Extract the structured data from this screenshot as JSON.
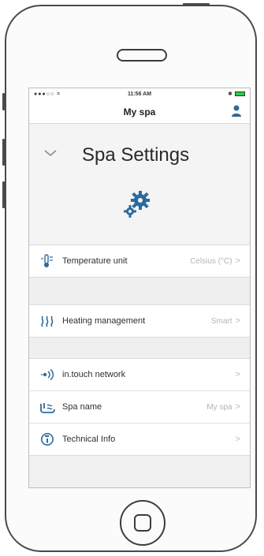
{
  "status_bar": {
    "carrier": "●●●○○ ⌗",
    "time": "11:56 AM",
    "bluetooth": "✱"
  },
  "nav": {
    "title": "My spa",
    "user_icon": "person-icon"
  },
  "header": {
    "title": "Spa Settings",
    "collapse_icon": "chevron-down-icon",
    "illustration_icon": "gears-icon"
  },
  "settings": {
    "group1": [
      {
        "icon": "thermometer-icon",
        "label": "Temperature unit",
        "value": "Celsius (°C)",
        "chevron": ">"
      }
    ],
    "group2": [
      {
        "icon": "heating-waves-icon",
        "label": "Heating management",
        "value": "Smart",
        "chevron": ">"
      }
    ],
    "group3": [
      {
        "icon": "network-signal-icon",
        "label": "in.touch network",
        "value": "",
        "chevron": ">"
      },
      {
        "icon": "spa-name-icon",
        "label": "Spa name",
        "value": "My spa",
        "chevron": ">"
      },
      {
        "icon": "info-icon",
        "label": "Technical Info",
        "value": "",
        "chevron": ">"
      }
    ]
  },
  "colors": {
    "accent": "#2b6a9e",
    "battery": "#2ecc40",
    "value_text": "#b4b4b4"
  }
}
